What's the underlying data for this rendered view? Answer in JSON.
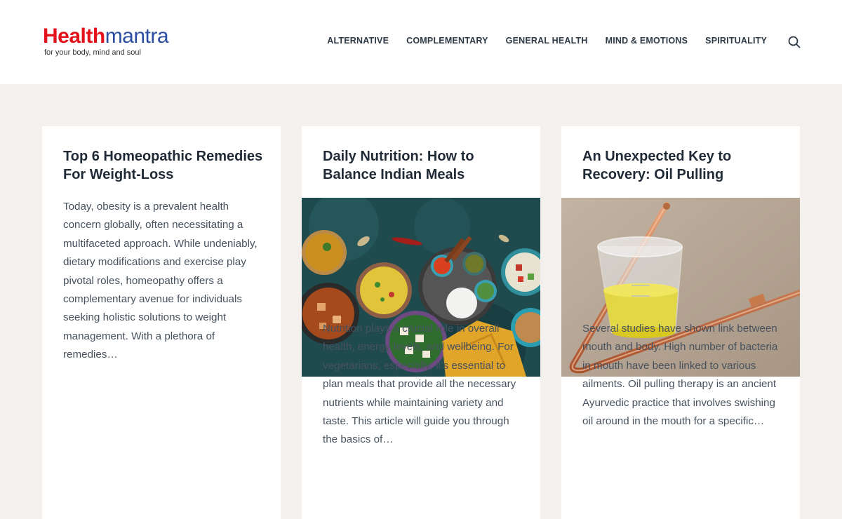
{
  "header": {
    "logo": {
      "part1": "Health",
      "part2": "mantra",
      "tagline": "for your body, mind and soul"
    },
    "nav": [
      {
        "label": "ALTERNATIVE"
      },
      {
        "label": "COMPLEMENTARY"
      },
      {
        "label": "GENERAL HEALTH"
      },
      {
        "label": "MIND & EMOTIONS"
      },
      {
        "label": "SPIRITUALITY"
      }
    ],
    "search_icon": "search-icon"
  },
  "colors": {
    "brand_red": "#e3131b",
    "brand_blue": "#2c4fa3",
    "page_background": "#f4f0ee",
    "card_background": "#ffffff",
    "heading_text": "#1f2a36",
    "body_text": "#47525e"
  },
  "posts": [
    {
      "title": "Top 6 Homeopathic Remedies For Weight-Loss",
      "excerpt": "Today, obesity is a prevalent health concern globally, often necessitating a multifaceted approach. While undeniably, dietary modifications and exercise play pivotal roles, homeopathy offers a complementary avenue for individuals seeking holistic solutions to weight management. With a plethora of remedies…"
    },
    {
      "title": "Daily Nutrition: How to Balance Indian Meals",
      "excerpt": "Nutrition plays a crucial role in overall health, energy levels, and wellbeing. For vegetarians, especially, it's essential to plan meals that provide all the necessary nutrients while maintaining variety and taste. This article will guide you through the basics of…"
    },
    {
      "title": "An Unexpected Key to Recovery: Oil Pulling",
      "excerpt": "Several studies have shown link between mouth and body. High number of bacteria in mouth have been linked to various ailments. Oil pulling therapy is an ancient Ayurvedic practice that involves swishing oil around in the mouth for a specific…"
    }
  ]
}
